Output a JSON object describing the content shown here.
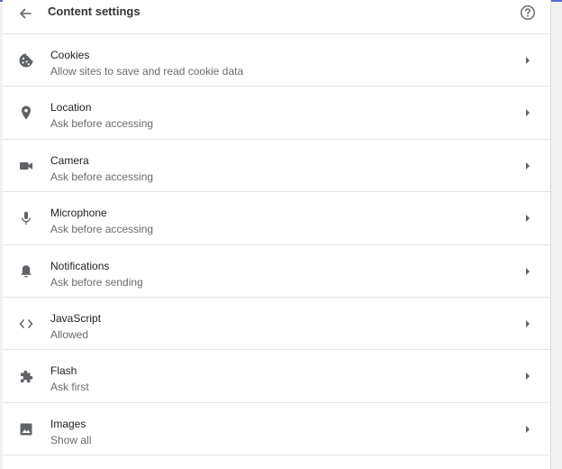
{
  "header": {
    "title": "Content settings",
    "back_icon": "back-arrow-icon",
    "help_icon": "help-circle-icon"
  },
  "settings": [
    {
      "label": "Cookies",
      "sub": "Allow sites to save and read cookie data",
      "icon": "cookie-icon"
    },
    {
      "label": "Location",
      "sub": "Ask before accessing",
      "icon": "location-pin-icon"
    },
    {
      "label": "Camera",
      "sub": "Ask before accessing",
      "icon": "camera-icon"
    },
    {
      "label": "Microphone",
      "sub": "Ask before accessing",
      "icon": "microphone-icon"
    },
    {
      "label": "Notifications",
      "sub": "Ask before sending",
      "icon": "bell-icon"
    },
    {
      "label": "JavaScript",
      "sub": "Allowed",
      "icon": "code-brackets-icon"
    },
    {
      "label": "Flash",
      "sub": "Ask first",
      "icon": "puzzle-icon"
    },
    {
      "label": "Images",
      "sub": "Show all",
      "icon": "image-icon"
    }
  ],
  "colors": {
    "accent_line": "#5b6bd6",
    "icon_gray": "#5f6368",
    "text_primary": "#222222",
    "text_secondary": "#6b6b6b"
  }
}
